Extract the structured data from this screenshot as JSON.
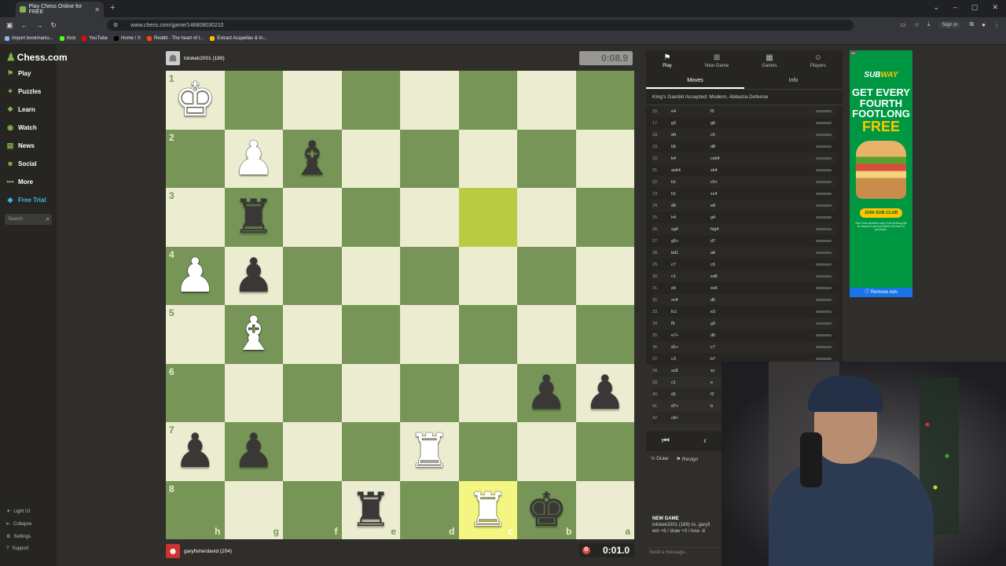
{
  "browser": {
    "tab_title": "Play Chess Online for FREE",
    "url": "www.chess.com/game/146808030210",
    "sign_in": "Sign in",
    "bookmarks": [
      {
        "label": "Import bookmarks...",
        "color": "#8ab4f8"
      },
      {
        "label": "Kick",
        "color": "#53fc18"
      },
      {
        "label": "YouTube",
        "color": "#ff0000"
      },
      {
        "label": "Home / X",
        "color": "#000000"
      },
      {
        "label": "Reddit - The heart of t...",
        "color": "#ff4500"
      },
      {
        "label": "Extract Acapellas & In...",
        "color": "#fbbc04"
      }
    ]
  },
  "nav": {
    "logo": "Chess.com",
    "items": [
      {
        "label": "Play",
        "icon": "play-icon"
      },
      {
        "label": "Puzzles",
        "icon": "puzzle-icon"
      },
      {
        "label": "Learn",
        "icon": "learn-icon"
      },
      {
        "label": "Watch",
        "icon": "watch-icon"
      },
      {
        "label": "News",
        "icon": "news-icon"
      },
      {
        "label": "Social",
        "icon": "social-icon"
      },
      {
        "label": "More",
        "icon": "more-icon"
      },
      {
        "label": "Free Trial",
        "icon": "diamond-icon"
      }
    ],
    "search_placeholder": "Search",
    "bottom": [
      "Light UI",
      "Collapse",
      "Settings",
      "Support"
    ]
  },
  "game": {
    "top_player": {
      "name": "lolokek2001 (189)",
      "clock": "0:08.9"
    },
    "bottom_player": {
      "name": "garyfisherdavid (204)",
      "clock": "0:01.0"
    },
    "ranks": [
      "1",
      "2",
      "3",
      "4",
      "5",
      "6",
      "7",
      "8"
    ],
    "files": [
      "h",
      "g",
      "f",
      "e",
      "d",
      "c",
      "b",
      "a"
    ],
    "board": [
      [
        "wK",
        "",
        "",
        "",
        "",
        "",
        "",
        ""
      ],
      [
        "",
        "wP",
        "bB",
        "",
        "",
        "",
        "",
        ""
      ],
      [
        "",
        "bR",
        "",
        "",
        "",
        "HL",
        "",
        ""
      ],
      [
        "wP",
        "bP",
        "",
        "",
        "",
        "",
        "",
        ""
      ],
      [
        "",
        "wB",
        "",
        "",
        "",
        "",
        "",
        ""
      ],
      [
        "",
        "",
        "",
        "",
        "",
        "",
        "bP",
        "bP"
      ],
      [
        "bP",
        "bP",
        "",
        "",
        "wR",
        "",
        "",
        ""
      ],
      [
        "",
        "",
        "",
        "bR",
        "",
        "wR*",
        "bK",
        ""
      ]
    ]
  },
  "panel": {
    "tabs": [
      {
        "label": "Play",
        "icon": "play-tab-icon"
      },
      {
        "label": "New Game",
        "icon": "new-game-icon"
      },
      {
        "label": "Games",
        "icon": "games-icon"
      },
      {
        "label": "Players",
        "icon": "players-icon"
      }
    ],
    "subtabs": [
      "Moves",
      "Info"
    ],
    "opening": "King's Gambit Accepted: Modern, Abbazia Defense",
    "moves": [
      [
        "16.",
        "e4",
        "f5"
      ],
      [
        "17.",
        "g3",
        "g6"
      ],
      [
        "18.",
        "d4",
        "c5"
      ],
      [
        "19.",
        "b5",
        "d8"
      ],
      [
        "20.",
        "b4",
        "cxb4"
      ],
      [
        "21.",
        "axb4",
        "xb4"
      ],
      [
        "22.",
        "b1",
        "c5+"
      ],
      [
        "23.",
        "h1",
        "xc4"
      ],
      [
        "24.",
        "d6",
        "e8"
      ],
      [
        "25.",
        "h4",
        "g4"
      ],
      [
        "26.",
        "xg4",
        "fxg4"
      ],
      [
        "27.",
        "g5+",
        "d7"
      ],
      [
        "28.",
        "bd1",
        "a6"
      ],
      [
        "29.",
        "c7",
        "c6"
      ],
      [
        "30.",
        "c1",
        "xd6"
      ],
      [
        "31.",
        "e6",
        "xe6"
      ],
      [
        "32.",
        "xc4",
        "d5"
      ],
      [
        "33.",
        "fc1",
        "e3"
      ],
      [
        "34.",
        "f5",
        "g3"
      ],
      [
        "35.",
        "e7+",
        "d6"
      ],
      [
        "36.",
        "d1+",
        "c7"
      ],
      [
        "37.",
        "c3",
        "b7"
      ],
      [
        "38.",
        "xc8",
        "xc"
      ],
      [
        "39.",
        "c1",
        "e"
      ],
      [
        "40.",
        "d1",
        "f2"
      ],
      [
        "41.",
        "d7+",
        "b"
      ],
      [
        "42.",
        "c8+",
        ""
      ]
    ],
    "actions": [
      "Draw",
      "Resign"
    ],
    "new_game_title": "NEW GAME",
    "new_game_line1": "lolokek2001 (189) vs. garyfi",
    "new_game_line2": "win +8 / draw +0 / lose -8",
    "message_placeholder": "Send a message..."
  },
  "ad": {
    "label": "AD",
    "brand_a": "SUB",
    "brand_b": "WAY",
    "line1": "GET EVERY",
    "line2": "FOURTH",
    "line3": "FOOTLONG",
    "line4": "FREE",
    "cta": "JOIN SUB CLUB",
    "fine": "Sub Club members only. Free footlong will be issued in account within 24 hours of purchase.",
    "remove": "Remove Ads"
  }
}
